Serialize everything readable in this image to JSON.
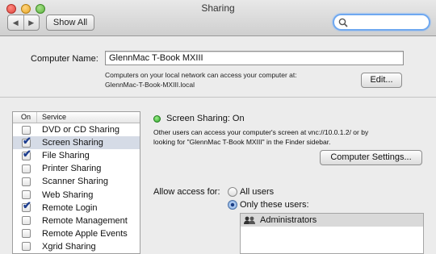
{
  "window": {
    "title": "Sharing"
  },
  "toolbar": {
    "back_label": "◀",
    "forward_label": "▶",
    "show_all_label": "Show All",
    "search_placeholder": ""
  },
  "computer_name": {
    "label": "Computer Name:",
    "value": "GlennMac T-Book MXIII",
    "note_line1": "Computers on your local network can access your computer at:",
    "note_line2": "GlennMac-T-Book-MXIII.local",
    "edit_label": "Edit..."
  },
  "services": {
    "header_on": "On",
    "header_service": "Service",
    "items": [
      {
        "label": "DVD or CD Sharing",
        "checked": false,
        "selected": false
      },
      {
        "label": "Screen Sharing",
        "checked": true,
        "selected": true
      },
      {
        "label": "File Sharing",
        "checked": true,
        "selected": false
      },
      {
        "label": "Printer Sharing",
        "checked": false,
        "selected": false
      },
      {
        "label": "Scanner Sharing",
        "checked": false,
        "selected": false
      },
      {
        "label": "Web Sharing",
        "checked": false,
        "selected": false
      },
      {
        "label": "Remote Login",
        "checked": true,
        "selected": false
      },
      {
        "label": "Remote Management",
        "checked": false,
        "selected": false
      },
      {
        "label": "Remote Apple Events",
        "checked": false,
        "selected": false
      },
      {
        "label": "Xgrid Sharing",
        "checked": false,
        "selected": false
      }
    ]
  },
  "detail": {
    "status": "Screen Sharing: On",
    "description_line1": "Other users can access your computer's screen at vnc://10.0.1.2/ or by",
    "description_line2": "looking for \"GlennMac T-Book MXIII\" in the Finder sidebar.",
    "computer_settings_label": "Computer Settings...",
    "allow_label": "Allow access for:",
    "option_all": "All users",
    "option_only": "Only these users:",
    "selected_option": "only",
    "users": [
      "Administrators"
    ]
  },
  "icons": {
    "search": "magnifier-icon",
    "group": "group-icon",
    "status": "status-light-icon"
  },
  "colors": {
    "status_green": "#2fa52a",
    "selection": "#d5dbe6",
    "check": "#1f3f8f",
    "focus_ring": "#6fa8f0"
  }
}
